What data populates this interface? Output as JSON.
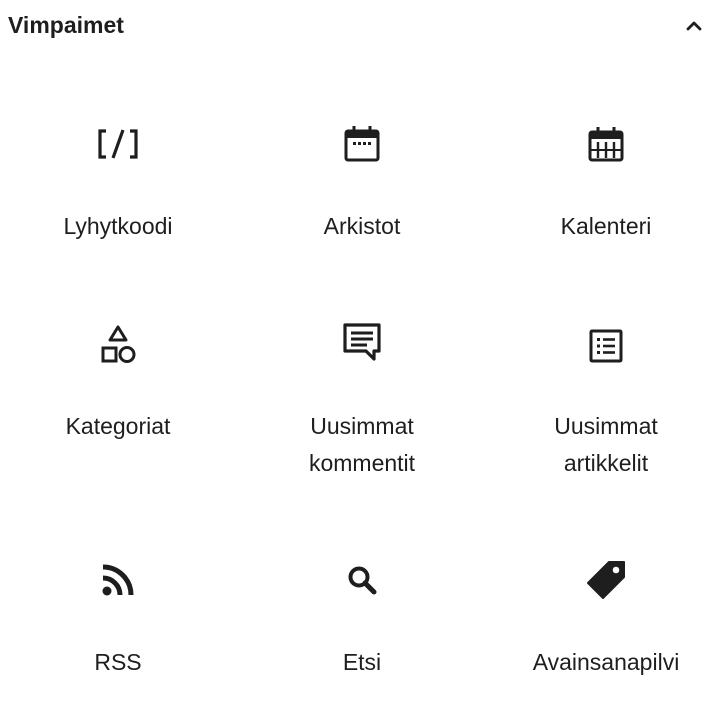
{
  "panel": {
    "title": "Vimpaimet",
    "toggle_icon": "chevron-up-icon"
  },
  "blocks": [
    {
      "label": "Lyhytkoodi",
      "icon": "shortcode-icon"
    },
    {
      "label": "Arkistot",
      "icon": "archive-calendar-icon"
    },
    {
      "label": "Kalenteri",
      "icon": "calendar-icon"
    },
    {
      "label": "Kategoriat",
      "icon": "categories-icon"
    },
    {
      "label": "Uusimmat kommentit",
      "label_line1": "Uusimmat",
      "label_line2": "kommentit",
      "icon": "comment-icon"
    },
    {
      "label": "Uusimmat artikkelit",
      "label_line1": "Uusimmat",
      "label_line2": "artikkelit",
      "icon": "post-list-icon"
    },
    {
      "label": "RSS",
      "icon": "rss-icon"
    },
    {
      "label": "Etsi",
      "icon": "search-icon"
    },
    {
      "label": "Avainsanapilvi",
      "icon": "tag-icon"
    }
  ],
  "colors": {
    "text": "#1e1e1e",
    "background": "#ffffff"
  }
}
